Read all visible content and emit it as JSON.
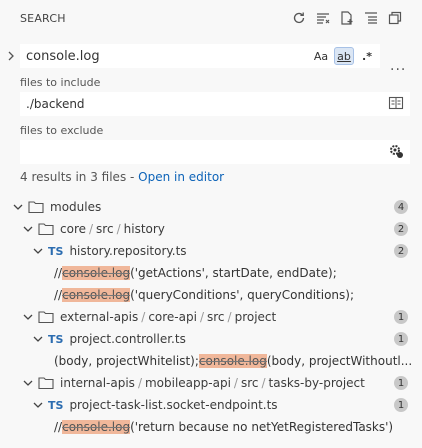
{
  "header": {
    "title": "SEARCH",
    "actions": [
      "refresh-icon",
      "clear-results-icon",
      "new-search-editor-icon",
      "collapse-all-icon",
      "open-in-editor-icon"
    ]
  },
  "search": {
    "query": "console.log",
    "match_case": "Aa",
    "whole_word": "ab",
    "regex": ".*"
  },
  "include": {
    "label": "files to include",
    "value": "./backend"
  },
  "exclude": {
    "label": "files to exclude",
    "value": ""
  },
  "summary": {
    "text": "4 results in 3 files - ",
    "link": "Open in editor"
  },
  "tree": {
    "root": {
      "name": "modules",
      "count": "4"
    },
    "group1": {
      "path": [
        "core",
        "src",
        "history"
      ],
      "count": "2",
      "file": {
        "name": "history.repository.ts",
        "count": "2"
      },
      "matches": [
        {
          "pre": "// ",
          "hl": "console.log",
          "post": "('getActions', startDate, endDate);"
        },
        {
          "pre": "// ",
          "hl": "console.log",
          "post": "('queryConditions', queryConditions);"
        }
      ]
    },
    "group2": {
      "path": [
        "external-apis",
        "core-api",
        "src",
        "project"
      ],
      "count": "1",
      "file": {
        "name": "project.controller.ts",
        "count": "1"
      },
      "matches": [
        {
          "pre": "(body, projectWhitelist); ",
          "hl": "console.log",
          "post": "(body, projectWithoutl..."
        }
      ]
    },
    "group3": {
      "path": [
        "internal-apis",
        "mobileapp-api",
        "src",
        "tasks-by-project"
      ],
      "count": "1",
      "file": {
        "name": "project-task-list.socket-endpoint.ts",
        "count": "1"
      },
      "matches": [
        {
          "pre": "//   ",
          "hl": "console.log",
          "post": "('return because no netYetRegisteredTasks')"
        }
      ]
    },
    "ts_label": "TS"
  }
}
